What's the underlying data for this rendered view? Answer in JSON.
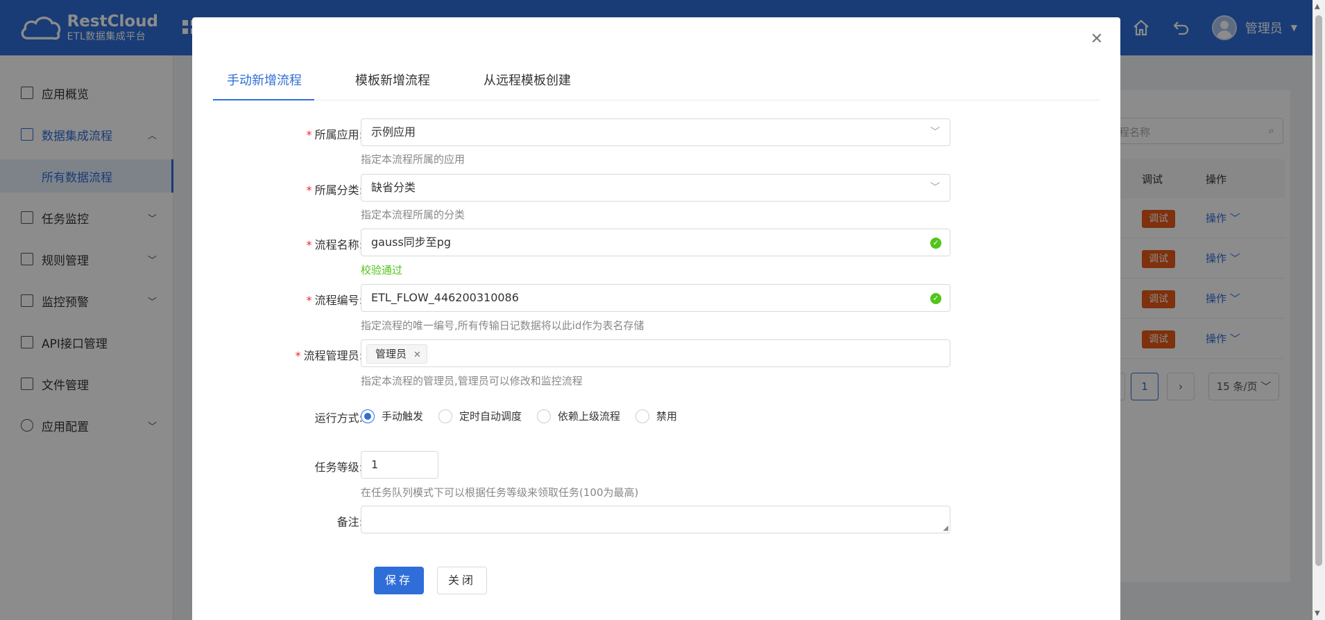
{
  "header": {
    "logo_title": "RestCloud",
    "logo_subtitle": "ETL数据集成平台",
    "user_name": "管理员"
  },
  "sidebar": {
    "items": [
      {
        "label": "应用概览",
        "icon": "overview-icon"
      },
      {
        "label": "数据集成流程",
        "icon": "grid-icon",
        "expanded": true
      },
      {
        "label": "所有数据流程",
        "sub": true
      },
      {
        "label": "任务监控",
        "icon": "monitor-icon"
      },
      {
        "label": "规则管理",
        "icon": "terminal-icon"
      },
      {
        "label": "监控预警",
        "icon": "alarm-icon"
      },
      {
        "label": "API接口管理",
        "icon": "api-icon"
      },
      {
        "label": "文件管理",
        "icon": "file-icon"
      },
      {
        "label": "应用配置",
        "icon": "gear-icon"
      }
    ]
  },
  "background": {
    "search_placeholder": "程名称",
    "col_debug": "调试",
    "col_action": "操作",
    "row_tag": "调试",
    "row_action": "操作",
    "page_current": "1",
    "page_size": "15 条/页"
  },
  "modal": {
    "tabs": [
      "手动新增流程",
      "模板新增流程",
      "从远程模板创建"
    ],
    "active_tab": 0,
    "fields": {
      "app": {
        "label": "所属应用:",
        "value": "示例应用",
        "help": "指定本流程所属的应用"
      },
      "category": {
        "label": "所属分类:",
        "value": "缺省分类",
        "help": "指定本流程所属的分类"
      },
      "name": {
        "label": "流程名称:",
        "value": "gauss同步至pg",
        "help": "校验通过"
      },
      "code": {
        "label": "流程编号:",
        "value": "ETL_FLOW_446200310086",
        "help": "指定流程的唯一编号,所有传输日记数据将以此id作为表名存储"
      },
      "admin": {
        "label": "流程管理员:",
        "tag": "管理员",
        "help": "指定本流程的管理员,管理员可以修改和监控流程"
      },
      "run_mode": {
        "label": "运行方式:",
        "options": [
          "手动触发",
          "定时自动调度",
          "依赖上级流程",
          "禁用"
        ],
        "selected": 0
      },
      "level": {
        "label": "任务等级:",
        "value": "1",
        "help": "在任务队列模式下可以根据任务等级来领取任务(100为最高)"
      },
      "remark": {
        "label": "备注:",
        "value": ""
      }
    },
    "save_label": "保存",
    "close_label": "关闭"
  },
  "colors": {
    "accent": "#2f6ed8",
    "success": "#52c41a",
    "required": "#f5222d",
    "debug_tag": "#e65a16"
  }
}
